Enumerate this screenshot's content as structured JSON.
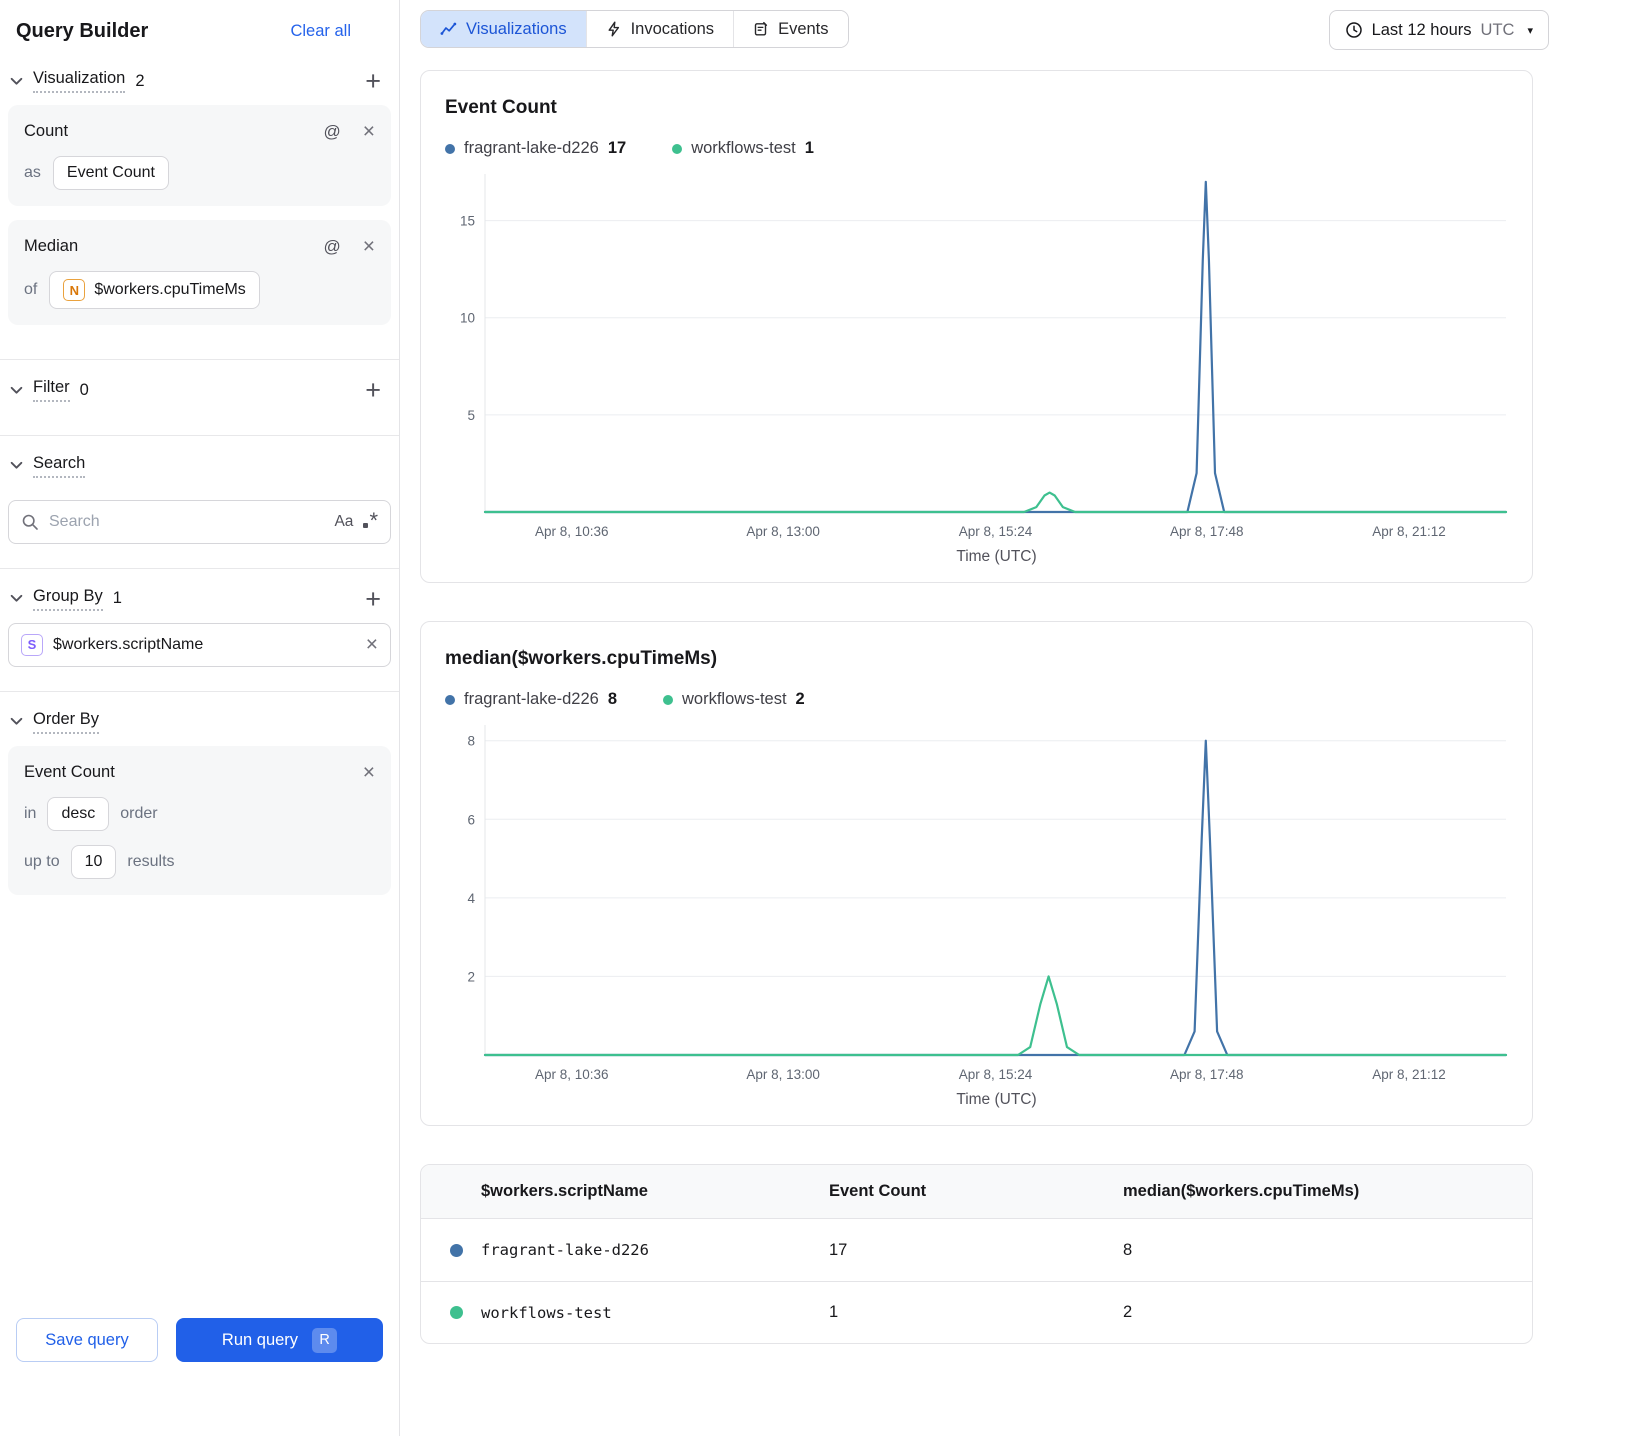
{
  "sidebar": {
    "title": "Query Builder",
    "clear_all": "Clear all",
    "visualization": {
      "label": "Visualization",
      "count": "2",
      "cards": [
        {
          "title": "Count",
          "prefix": "as",
          "value": "Event Count"
        },
        {
          "title": "Median",
          "prefix": "of",
          "badge": "N",
          "value": "$workers.cpuTimeMs"
        }
      ]
    },
    "filter": {
      "label": "Filter",
      "count": "0"
    },
    "search": {
      "label": "Search",
      "placeholder": "Search"
    },
    "group_by": {
      "label": "Group By",
      "count": "1",
      "badge": "S",
      "value": "$workers.scriptName"
    },
    "order_by": {
      "label": "Order By",
      "field": "Event Count",
      "in_label": "in",
      "direction": "desc",
      "order_label": "order",
      "upto_label": "up to",
      "limit": "10",
      "results_label": "results"
    },
    "save_label": "Save query",
    "run_label": "Run query",
    "run_shortcut": "R"
  },
  "header": {
    "tabs": [
      {
        "label": "Visualizations"
      },
      {
        "label": "Invocations"
      },
      {
        "label": "Events"
      }
    ],
    "time_range": {
      "label": "Last 12 hours",
      "zone": "UTC"
    }
  },
  "icons": {
    "at": "@",
    "close": "×",
    "plus": "+",
    "caret": "▾",
    "match_case": "Aa",
    "asterisk": "*"
  },
  "chart_data": [
    {
      "type": "line",
      "title": "Event Count",
      "xlabel": "Time (UTC)",
      "ylim": [
        0,
        17.4
      ],
      "y_ticks": [
        5,
        10,
        15
      ],
      "x_ticks": [
        {
          "label": "Apr 8, 10:36",
          "f": 0.085
        },
        {
          "label": "Apr 8, 13:00",
          "f": 0.292
        },
        {
          "label": "Apr 8, 15:24",
          "f": 0.5
        },
        {
          "label": "Apr 8, 17:48",
          "f": 0.707
        },
        {
          "label": "Apr 8, 21:12",
          "f": 0.905
        }
      ],
      "series": [
        {
          "name": "fragrant-lake-d226",
          "total": 17,
          "color": "#4273a8",
          "points": [
            [
              0,
              0
            ],
            [
              0.688,
              0
            ],
            [
              0.697,
              2
            ],
            [
              0.703,
              13
            ],
            [
              0.706,
              17
            ],
            [
              0.709,
              13
            ],
            [
              0.715,
              2
            ],
            [
              0.724,
              0
            ],
            [
              1,
              0
            ]
          ]
        },
        {
          "name": "workflows-test",
          "total": 1,
          "color": "#3ec08f",
          "points": [
            [
              0,
              0
            ],
            [
              0.528,
              0
            ],
            [
              0.54,
              0.25
            ],
            [
              0.548,
              0.85
            ],
            [
              0.553,
              1
            ],
            [
              0.558,
              0.85
            ],
            [
              0.566,
              0.25
            ],
            [
              0.578,
              0
            ],
            [
              1,
              0
            ]
          ]
        }
      ]
    },
    {
      "type": "line",
      "title": "median($workers.cpuTimeMs)",
      "xlabel": "Time (UTC)",
      "ylim": [
        0,
        8.4
      ],
      "y_ticks": [
        2,
        4,
        6,
        8
      ],
      "x_ticks": [
        {
          "label": "Apr 8, 10:36",
          "f": 0.085
        },
        {
          "label": "Apr 8, 13:00",
          "f": 0.292
        },
        {
          "label": "Apr 8, 15:24",
          "f": 0.5
        },
        {
          "label": "Apr 8, 17:48",
          "f": 0.707
        },
        {
          "label": "Apr 8, 21:12",
          "f": 0.905
        }
      ],
      "series": [
        {
          "name": "fragrant-lake-d226",
          "total": 8,
          "color": "#4273a8",
          "points": [
            [
              0,
              0
            ],
            [
              0.685,
              0
            ],
            [
              0.695,
              0.6
            ],
            [
              0.702,
              5.5
            ],
            [
              0.706,
              8
            ],
            [
              0.71,
              5.5
            ],
            [
              0.717,
              0.6
            ],
            [
              0.727,
              0
            ],
            [
              1,
              0
            ]
          ]
        },
        {
          "name": "workflows-test",
          "total": 2,
          "color": "#3ec08f",
          "points": [
            [
              0,
              0
            ],
            [
              0.522,
              0
            ],
            [
              0.534,
              0.2
            ],
            [
              0.544,
              1.3
            ],
            [
              0.552,
              2
            ],
            [
              0.56,
              1.3
            ],
            [
              0.57,
              0.2
            ],
            [
              0.582,
              0
            ],
            [
              1,
              0
            ]
          ]
        }
      ]
    }
  ],
  "table": {
    "columns": [
      "$workers.scriptName",
      "Event Count",
      "median($workers.cpuTimeMs)"
    ],
    "rows": [
      {
        "script_name": "fragrant-lake-d226",
        "event_count": "17",
        "median": "8",
        "color": "#4273a8"
      },
      {
        "script_name": "workflows-test",
        "event_count": "1",
        "median": "2",
        "color": "#3ec08f"
      }
    ]
  }
}
